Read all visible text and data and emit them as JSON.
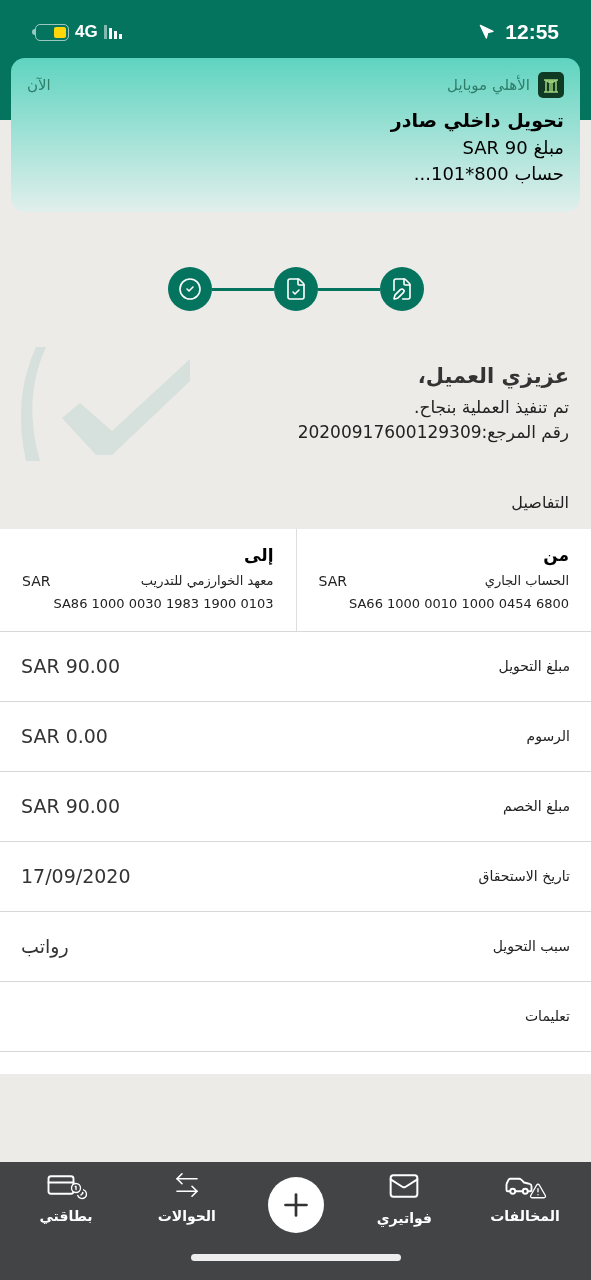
{
  "status_bar": {
    "network": "4G",
    "time": "12:55"
  },
  "notification": {
    "app": "الأهلي موبايل",
    "time": "الآن",
    "title": "تحويل داخلي صادر",
    "lines": [
      "مبلغ SAR 90",
      "حساب 800*101..."
    ]
  },
  "steps": [
    {
      "kind": "edit"
    },
    {
      "kind": "document"
    },
    {
      "kind": "check"
    }
  ],
  "message": {
    "greeting": "عزيزي العميل،",
    "status": "تم تنفيذ العملية بنجاح.",
    "reference": "رقم المرجع:20200917600129309"
  },
  "details_title": "التفاصيل",
  "parties": [
    {
      "label": "من",
      "name": "الحساب الجاري",
      "currency": "SAR",
      "iban": "SA66 1000 0010 1000 0454 6800"
    },
    {
      "label": "إلى",
      "name": "معهد الخوارزمي للتدريب",
      "currency": "SAR",
      "iban": "SA86 1000 0030 1983 1900 0103"
    }
  ],
  "rows": [
    {
      "label": "مبلغ التحويل",
      "value": "SAR 90.00"
    },
    {
      "label": "الرسوم",
      "value": "SAR 0.00"
    },
    {
      "label": "مبلغ الخصم",
      "value": "SAR 90.00"
    },
    {
      "label": "تاريخ الاستحقاق",
      "value": "17/09/2020"
    },
    {
      "label": "سبب التحويل",
      "value": "رواتب"
    },
    {
      "label": "تعليمات"
    }
  ],
  "nav": [
    {
      "kind": "violations",
      "label": "المخالفات"
    },
    {
      "kind": "bills",
      "label": "فواتيري"
    },
    {
      "kind": "add"
    },
    {
      "kind": "transfers",
      "label": "الحوالات"
    },
    {
      "kind": "cards",
      "label": "بطاقتي"
    }
  ]
}
